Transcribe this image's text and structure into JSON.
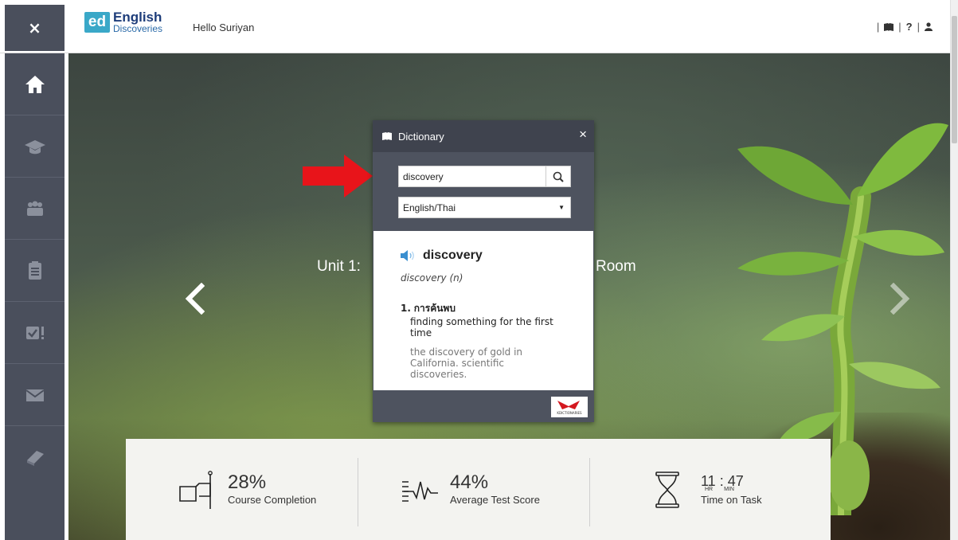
{
  "header": {
    "logo_short": "ed",
    "logo_big": "English",
    "logo_small": "Discoveries",
    "greeting": "Hello Suriyan",
    "close_label": "×",
    "icon_sep": "|",
    "help_label": "?"
  },
  "sidebar": {
    "items": [
      {
        "icon": "home-icon",
        "active": true
      },
      {
        "icon": "graduation-cap-icon"
      },
      {
        "icon": "users-icon"
      },
      {
        "icon": "clipboard-icon"
      },
      {
        "icon": "assessment-icon"
      },
      {
        "icon": "mail-icon"
      },
      {
        "icon": "book-icon"
      }
    ]
  },
  "hero": {
    "title_left": "Unit 1:",
    "title_right": "Room"
  },
  "dictionary": {
    "title": "Dictionary",
    "close_label": "×",
    "search_value": "discovery",
    "language": "English/Thai",
    "entry": {
      "word": "discovery",
      "pos": "discovery (n)",
      "senses": [
        {
          "num": "1.",
          "translation": "การค้นพบ",
          "definition": "finding something for the first time",
          "example": "the discovery of gold in California. scientific discoveries."
        }
      ]
    },
    "provider_label": "KDICTIONARIES"
  },
  "stats": {
    "completion_value": "28%",
    "completion_label": "Course Completion",
    "score_value": "44%",
    "score_label": "Average Test Score",
    "time_hr": "11",
    "time_sep": ":",
    "time_min": "47",
    "hr_unit": "HR",
    "min_unit": "MIN",
    "time_label": "Time on Task"
  },
  "colors": {
    "sidebar_bg": "#4a4f5c",
    "logo_accent": "#3aa8c8",
    "annotation_arrow": "#e8141a",
    "dict_header": "#3f434e"
  }
}
